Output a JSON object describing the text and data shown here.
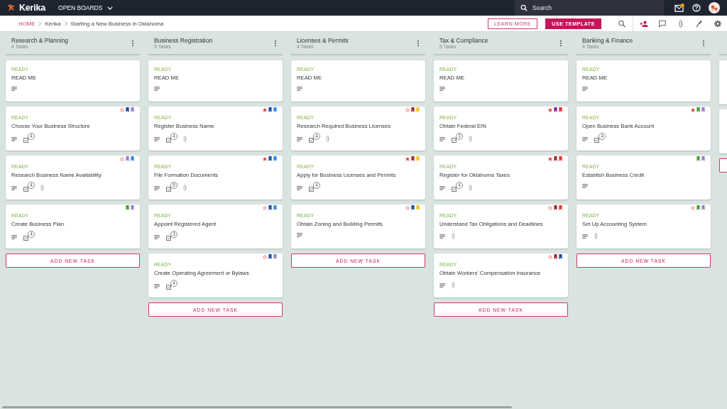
{
  "top_bar": {
    "app_name": "Kerika",
    "boards_menu": "OPEN BOARDS",
    "search": {
      "placeholder": "Search"
    },
    "notifications": true
  },
  "breadcrumb": [
    "HOME",
    "Kerika",
    "Starting a New Business in Oklahoma"
  ],
  "actions": {
    "learn_more": "LEARN MORE",
    "use_template": "USE TEMPLATE"
  },
  "columns": [
    {
      "kind": "full",
      "title": "Research & Planning",
      "task_count": "4 Tasks",
      "add_label": "ADD NEW TASK",
      "cards": [
        {
          "kind": "task",
          "status": "READY",
          "title": "READ ME",
          "attachment": false
        },
        {
          "kind": "task",
          "status": "READY",
          "title": "Choose Your Business Structure",
          "starred": false,
          "tags": [
            {
              "color": "#1e4fa3"
            },
            {
              "color": "#9c7fd0"
            }
          ],
          "checklist": "4",
          "attachment": false
        },
        {
          "kind": "task",
          "status": "READY",
          "title": "Research Business Name Availability",
          "starred": false,
          "tags": [
            {
              "color": "#9c7fd0"
            },
            {
              "color": "#2b8be6"
            }
          ],
          "checklist": "4",
          "attachment": true
        },
        {
          "kind": "task",
          "status": "READY",
          "title": "Create Business Plan",
          "tags": [
            {
              "color": "#4e9a3a"
            },
            {
              "color": "#9c7fd0"
            }
          ],
          "checklist": "4",
          "attachment": false
        }
      ]
    },
    {
      "kind": "full",
      "title": "Business Registration",
      "task_count": "5 Tasks",
      "add_label": "ADD NEW TASK",
      "cards": [
        {
          "kind": "task",
          "status": "READY",
          "title": "READ ME",
          "attachment": false
        },
        {
          "kind": "task",
          "status": "READY",
          "title": "Register Business Name",
          "starred": true,
          "tags": [
            {
              "color": "#1e4fa3"
            },
            {
              "color": "#2b8be6"
            }
          ],
          "checklist": "4",
          "attachment": true
        },
        {
          "kind": "task",
          "status": "READY",
          "title": "File Formation Documents",
          "starred": true,
          "tags": [
            {
              "color": "#1e4fa3"
            },
            {
              "color": "#2b8be6"
            }
          ],
          "checklist": "5",
          "attachment": true
        },
        {
          "kind": "task",
          "status": "READY",
          "title": "Appoint Registered Agent",
          "starred": false,
          "tags": [
            {
              "color": "#1e4fa3"
            },
            {
              "color": "#2b8be6"
            }
          ],
          "checklist": "3",
          "attachment": false
        },
        {
          "kind": "task",
          "status": "READY",
          "title": "Create Operating Agreement or Bylaws",
          "starred": false,
          "tags": [
            {
              "color": "#1e4fa3"
            },
            {
              "color": "#9c7fd0"
            }
          ],
          "checklist": "4",
          "attachment": false
        }
      ]
    },
    {
      "kind": "full",
      "title": "Licenses & Permits",
      "task_count": "4 Tasks",
      "add_label": "ADD NEW TASK",
      "cards": [
        {
          "kind": "task",
          "status": "READY",
          "title": "READ ME",
          "attachment": false
        },
        {
          "kind": "task",
          "status": "READY",
          "title": "Research Required Business Licenses",
          "starred": false,
          "tags": [
            {
              "color": "#a3302a"
            },
            {
              "color": "#f5c21b"
            }
          ],
          "checklist": "4",
          "attachment": true
        },
        {
          "kind": "task",
          "status": "READY",
          "title": "Apply for Business Licenses and Permits",
          "starred": true,
          "tags": [
            {
              "color": "#a3302a"
            },
            {
              "color": "#f5c21b"
            }
          ],
          "checklist": "4",
          "attachment": false
        },
        {
          "kind": "task",
          "status": "READY",
          "title": "Obtain Zoning and Building Permits",
          "starred": false,
          "tags": [
            {
              "color": "#1e4fa3"
            },
            {
              "color": "#f5c21b"
            }
          ],
          "attachment": false
        }
      ]
    },
    {
      "kind": "full",
      "title": "Tax & Compliance",
      "task_count": "5 Tasks",
      "add_label": "ADD NEW TASK",
      "cards": [
        {
          "kind": "task",
          "status": "READY",
          "title": "READ ME",
          "attachment": false
        },
        {
          "kind": "task",
          "status": "READY",
          "title": "Obtain Federal EIN",
          "starred": true,
          "tags": [
            {
              "color": "#8e2a9e"
            },
            {
              "color": "#e53935"
            }
          ],
          "checklist": "3",
          "attachment": true
        },
        {
          "kind": "task",
          "status": "READY",
          "title": "Register for Oklahoma Taxes",
          "starred": true,
          "tags": [
            {
              "color": "#a3302a"
            },
            {
              "color": "#e53935"
            }
          ],
          "checklist": "4",
          "attachment": true
        },
        {
          "kind": "task",
          "status": "READY",
          "title": "Understand Tax Obligations and Deadlines",
          "starred": false,
          "tags": [
            {
              "color": "#a3302a"
            },
            {
              "color": "#e53935"
            }
          ],
          "attachment": true
        },
        {
          "kind": "task",
          "status": "READY",
          "title": "Obtain Workers' Compensation Insurance",
          "starred": false,
          "tags": [
            {
              "color": "#a3302a"
            },
            {
              "color": "#1e4fa3"
            }
          ],
          "attachment": true
        }
      ]
    },
    {
      "kind": "full",
      "title": "Banking & Finance",
      "task_count": "4 Tasks",
      "add_label": "ADD NEW TASK",
      "cards": [
        {
          "kind": "task",
          "status": "READY",
          "title": "READ ME",
          "attachment": false
        },
        {
          "kind": "task",
          "status": "READY",
          "title": "Open Business Bank Account",
          "starred": true,
          "tags": [
            {
              "color": "#4e9a3a"
            },
            {
              "color": "#9c7fd0"
            }
          ],
          "checklist": "4",
          "attachment": false
        },
        {
          "kind": "task",
          "status": "READY",
          "title": "Establish Business Credit",
          "tags": [
            {
              "color": "#4e9a3a"
            },
            {
              "color": "#9c7fd0"
            }
          ],
          "attachment": false
        },
        {
          "kind": "task",
          "status": "READY",
          "title": "Set Up Accounting System",
          "starred": false,
          "tags": [
            {
              "color": "#4e9a3a"
            },
            {
              "color": "#9c7fd0"
            }
          ],
          "attachment": true
        }
      ]
    },
    {
      "kind": "partial",
      "cards": [
        {
          "kind": "stub"
        },
        {
          "kind": "stub"
        }
      ]
    }
  ]
}
